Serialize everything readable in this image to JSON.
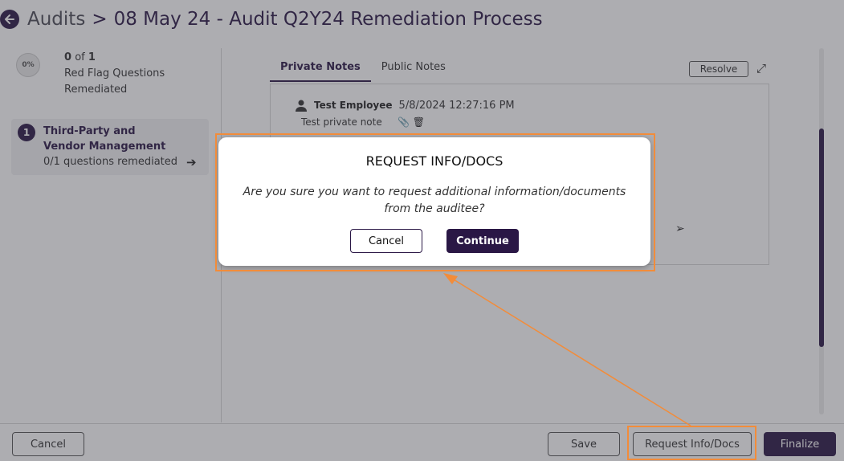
{
  "header": {
    "breadcrumb_root": "Audits",
    "breadcrumb_sep": ">",
    "page_title": "08 May 24 - Audit Q2Y24 Remediation Process"
  },
  "progress": {
    "percent_label": "0%",
    "count": "0",
    "of_label": "of",
    "total": "1",
    "line1": "Red Flag Questions",
    "line2": "Remediated"
  },
  "section": {
    "number": "1",
    "title": "Third-Party and Vendor Management",
    "subtitle": "0/1 questions remediated"
  },
  "notes": {
    "tabs": [
      {
        "label": "Private Notes",
        "active": true
      },
      {
        "label": "Public Notes",
        "active": false
      }
    ],
    "resolve_label": "Resolve",
    "entries": [
      {
        "author": "Test Employee",
        "timestamp": "5/8/2024 12:27:16 PM",
        "text": "Test private note"
      }
    ]
  },
  "footer": {
    "cancel_label": "Cancel",
    "save_label": "Save",
    "request_label": "Request Info/Docs",
    "finalize_label": "Finalize"
  },
  "modal": {
    "title": "REQUEST INFO/DOCS",
    "body": "Are you sure you want to request additional information/documents from the auditee?",
    "cancel_label": "Cancel",
    "continue_label": "Continue"
  },
  "colors": {
    "brand": "#2a1745",
    "highlight": "#f28c3a"
  }
}
